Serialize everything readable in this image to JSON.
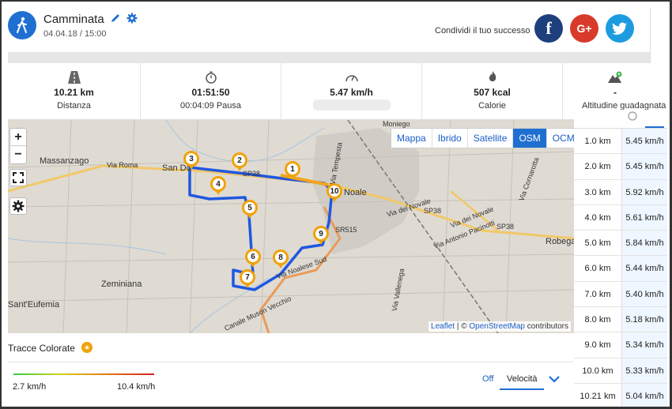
{
  "header": {
    "title": "Camminata",
    "date": "04.04.18 / 15:00",
    "share_label": "Condividi il tuo successo",
    "share_buttons": {
      "facebook": "f",
      "google": "G+"
    }
  },
  "stats": [
    {
      "value": "10.21 km",
      "label": "Distanza",
      "icon": "road-icon"
    },
    {
      "value": "01:51:50",
      "label": "00:04:09 Pausa",
      "icon": "stopwatch-icon"
    },
    {
      "value": "5.47 km/h",
      "label": "",
      "icon": "speedometer-icon"
    },
    {
      "value": "507 kcal",
      "label": "Calorie",
      "icon": "flame-icon"
    },
    {
      "value": "-",
      "label": "Altitudine guadagnata",
      "icon": "mountain-icon"
    }
  ],
  "map": {
    "layers": [
      "Mappa",
      "Ibrido",
      "Satellite",
      "OSM",
      "OCM"
    ],
    "active_layer": "OSM",
    "zoom_in": "+",
    "zoom_out": "−",
    "attribution_leaflet": "Leaflet",
    "attribution_sep": " | © ",
    "attribution_osm": "OpenStreetMap",
    "attribution_tail": " contributors",
    "places": [
      {
        "name": "Moniego"
      },
      {
        "name": "Massanzago"
      },
      {
        "name": "San Do"
      },
      {
        "name": "Via Roma"
      },
      {
        "name": "SP38"
      },
      {
        "name": "Noale"
      },
      {
        "name": "SP38"
      },
      {
        "name": "SR515"
      },
      {
        "name": "Via del Novale"
      },
      {
        "name": "Via Antonio Pacinotti"
      },
      {
        "name": "SP38"
      },
      {
        "name": "Robega"
      },
      {
        "name": "Via Noalese Sud"
      },
      {
        "name": "Zeminiana"
      },
      {
        "name": "Sant'Eufemia"
      },
      {
        "name": "Via Vallenega"
      },
      {
        "name": "Via Cornarotta"
      },
      {
        "name": "Canale Muson Vecchio"
      },
      {
        "name": "Via Tempesta"
      },
      {
        "name": "Via dei Novale"
      }
    ],
    "markers": [
      "1",
      "2",
      "3",
      "4",
      "5",
      "6",
      "7",
      "8",
      "9",
      "10"
    ]
  },
  "splits": [
    {
      "km": "1.0 km",
      "speed": "5.45 km/h"
    },
    {
      "km": "2.0 km",
      "speed": "5.45 km/h"
    },
    {
      "km": "3.0 km",
      "speed": "5.92 km/h"
    },
    {
      "km": "4.0 km",
      "speed": "5.61 km/h"
    },
    {
      "km": "5.0 km",
      "speed": "5.84 km/h"
    },
    {
      "km": "6.0 km",
      "speed": "5.44 km/h"
    },
    {
      "km": "7.0 km",
      "speed": "5.40 km/h"
    },
    {
      "km": "8.0 km",
      "speed": "5.18 km/h"
    },
    {
      "km": "9.0 km",
      "speed": "5.34 km/h"
    },
    {
      "km": "10.0 km",
      "speed": "5.33 km/h"
    },
    {
      "km": "10.21 km",
      "speed": "5.04 km/h"
    }
  ],
  "bottom": {
    "title": "Tracce Colorate",
    "min_speed": "2.7 km/h",
    "max_speed": "10.4 km/h",
    "off_label": "Off",
    "selected_metric": "Velocità"
  },
  "colors": {
    "accent": "#1f6fd1",
    "marker": "#f0a20a",
    "facebook": "#1d3f7c",
    "google": "#d83b2b",
    "twitter": "#1d9be0"
  }
}
